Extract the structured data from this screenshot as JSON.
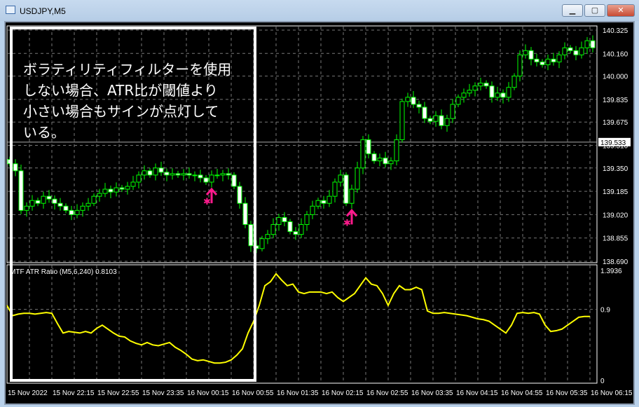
{
  "window": {
    "title": "USDJPY,M5",
    "minimize": "▁",
    "maximize": "▢",
    "close": "✕"
  },
  "colors": {
    "bull_outline": "#00ff00",
    "bear_body": "#ffffff",
    "indicator": "#ffff00",
    "signal": "#ff1a8c",
    "annotation_border": "#ffffff"
  },
  "annotation": {
    "lines": [
      "ボラティリティフィルターを使用",
      "しない場合、ATR比が閾値より",
      "小さい場合もサインが点灯して",
      "いる。"
    ]
  },
  "chart_data": [
    {
      "type": "candlestick",
      "symbol": "USDJPY",
      "timeframe": "M5",
      "y_ticks": [
        "140.325",
        "140.160",
        "140.000",
        "139.835",
        "139.675",
        "139.510",
        "139.350",
        "139.185",
        "139.020",
        "138.855",
        "138.690"
      ],
      "ylim": [
        138.69,
        140.325
      ],
      "current_price": "139.533",
      "x_ticks": [
        "15 Nov 2022",
        "15 Nov 22:15",
        "15 Nov 22:55",
        "15 Nov 23:35",
        "16 Nov 00:15",
        "16 Nov 00:55",
        "16 Nov 01:35",
        "16 Nov 02:15",
        "16 Nov 02:55",
        "16 Nov 03:35",
        "16 Nov 04:15",
        "16 Nov 04:55",
        "16 Nov 05:35",
        "16 Nov 06:15"
      ],
      "close": [
        139.38,
        139.33,
        139.05,
        139.08,
        139.12,
        139.1,
        139.15,
        139.13,
        139.1,
        139.08,
        139.05,
        139.02,
        139.05,
        139.08,
        139.1,
        139.15,
        139.17,
        139.2,
        139.18,
        139.21,
        139.2,
        139.22,
        139.25,
        139.3,
        139.33,
        139.3,
        139.35,
        139.32,
        139.3,
        139.31,
        139.3,
        139.31,
        139.3,
        139.3,
        139.28,
        139.25,
        139.3,
        139.3,
        139.31,
        139.3,
        139.22,
        139.1,
        138.95,
        138.8,
        138.78,
        138.85,
        138.88,
        138.95,
        139.0,
        138.97,
        138.9,
        138.88,
        138.95,
        139.02,
        139.08,
        139.12,
        139.1,
        139.15,
        139.25,
        139.3,
        139.1,
        139.2,
        139.35,
        139.55,
        139.45,
        139.4,
        139.42,
        139.38,
        139.4,
        139.55,
        139.82,
        139.85,
        139.8,
        139.78,
        139.7,
        139.68,
        139.72,
        139.65,
        139.7,
        139.8,
        139.85,
        139.88,
        139.9,
        139.93,
        139.95,
        139.93,
        139.85,
        139.88,
        139.85,
        139.92,
        140.0,
        140.15,
        140.18,
        140.12,
        140.1,
        140.08,
        140.12,
        140.1,
        140.15,
        140.2,
        140.18,
        140.15,
        140.2,
        140.25,
        140.2
      ],
      "signals": [
        {
          "type": "buy-arrow",
          "bar": 36
        },
        {
          "type": "buy-arrow",
          "bar": 61
        }
      ]
    },
    {
      "type": "line",
      "name": "MTF ATR Ratio",
      "label": "MTF ATR Ratio  (M5,6,240) 0.8103",
      "y_ticks": [
        "1.3936",
        "0.9",
        "0"
      ],
      "ylim": [
        0,
        1.3936
      ],
      "values": [
        0.95,
        0.82,
        0.84,
        0.85,
        0.85,
        0.84,
        0.85,
        0.86,
        0.85,
        0.72,
        0.6,
        0.62,
        0.61,
        0.6,
        0.62,
        0.6,
        0.66,
        0.7,
        0.65,
        0.6,
        0.56,
        0.55,
        0.5,
        0.47,
        0.45,
        0.48,
        0.45,
        0.44,
        0.46,
        0.48,
        0.42,
        0.38,
        0.33,
        0.27,
        0.25,
        0.26,
        0.24,
        0.22,
        0.22,
        0.23,
        0.26,
        0.32,
        0.4,
        0.6,
        0.75,
        0.95,
        1.2,
        1.25,
        1.35,
        1.27,
        1.2,
        1.22,
        1.12,
        1.1,
        1.12,
        1.12,
        1.12,
        1.1,
        1.12,
        1.05,
        1.0,
        1.05,
        1.1,
        1.2,
        1.3,
        1.22,
        1.2,
        1.1,
        0.95,
        1.1,
        1.2,
        1.15,
        1.15,
        1.18,
        1.15,
        0.88,
        0.85,
        0.85,
        0.86,
        0.85,
        0.84,
        0.83,
        0.82,
        0.8,
        0.78,
        0.77,
        0.75,
        0.7,
        0.65,
        0.6,
        0.7,
        0.85,
        0.86,
        0.85,
        0.86,
        0.84,
        0.7,
        0.62,
        0.63,
        0.65,
        0.7,
        0.75,
        0.8,
        0.81,
        0.81
      ]
    }
  ]
}
